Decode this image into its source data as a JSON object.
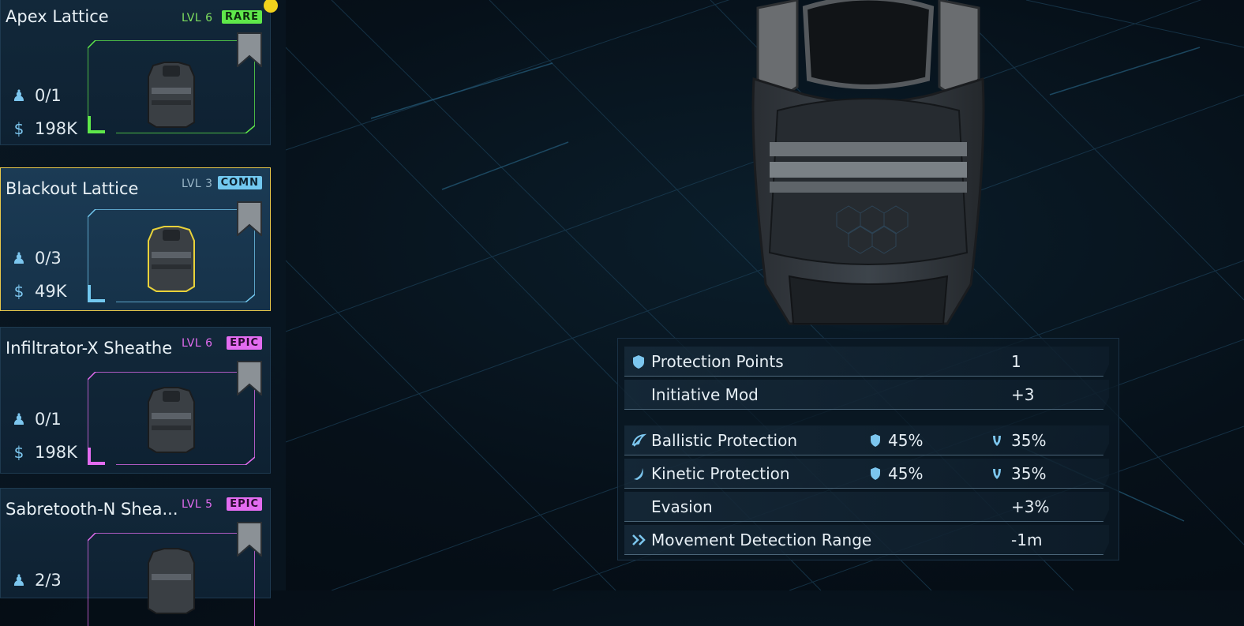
{
  "items": [
    {
      "name": "Apex Lattice",
      "level": "LVL 6",
      "rarity": "RARE",
      "assigned": "0/1",
      "cost": "198K",
      "color": "#5fe84a",
      "badge_text": "#0d2a0f"
    },
    {
      "name": "Blackout Lattice",
      "level": "LVL 3",
      "rarity": "COMN",
      "assigned": "0/3",
      "cost": "49K",
      "color": "#72c8ef",
      "badge_text": "#0d2230"
    },
    {
      "name": "Infiltrator-X Sheathe",
      "level": "LVL 6",
      "rarity": "EPIC",
      "assigned": "0/1",
      "cost": "198K",
      "color": "#e36cf0",
      "badge_text": "#2a0b30"
    },
    {
      "name": "Sabretooth-N Shea...",
      "level": "LVL 5",
      "rarity": "EPIC",
      "assigned": "2/3",
      "cost": "",
      "color": "#e36cf0",
      "badge_text": "#2a0b30"
    }
  ],
  "stats": {
    "protection_points": {
      "label": "Protection Points",
      "value": "1",
      "icon": "shield-icon"
    },
    "initiative_mod": {
      "label": "Initiative Mod",
      "value": "+3"
    },
    "ballistic": {
      "label": "Ballistic Protection",
      "armor": "45%",
      "health": "35%",
      "icon": "ballistic-icon"
    },
    "kinetic": {
      "label": "Kinetic Protection",
      "armor": "45%",
      "health": "35%",
      "icon": "kinetic-icon"
    },
    "evasion": {
      "label": "Evasion",
      "value": "+3%"
    },
    "movement": {
      "label": "Movement Detection Range",
      "value": "-1m",
      "icon": "double-chevron-icon"
    }
  },
  "colors": {
    "accent": "#7cc6ee",
    "selected_border": "#e8c84a"
  }
}
